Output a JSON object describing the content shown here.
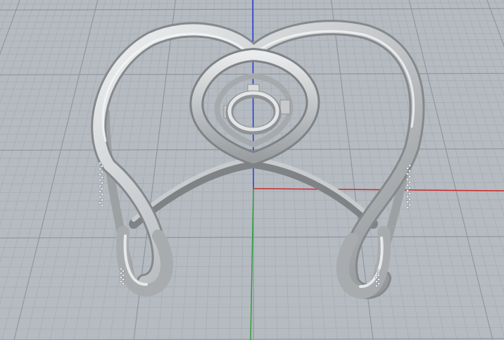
{
  "viewport": {
    "view": "perspective",
    "background_color": "#b5bbc1",
    "grid": {
      "visible": true,
      "minor_line_color": "#a6adb4",
      "major_line_color": "#8f979f"
    },
    "axes": {
      "x_axis_color": "#cc2b2b",
      "y_axis_color": "#2e9e3a",
      "z_axis_color": "#2b3fd0"
    }
  },
  "model": {
    "object": "cuff-bracelet",
    "material_color": "#c9cbcd",
    "shade_light": "#eceded",
    "shade_dark": "#8e9194",
    "shade_mid": "#b3b6b9"
  }
}
